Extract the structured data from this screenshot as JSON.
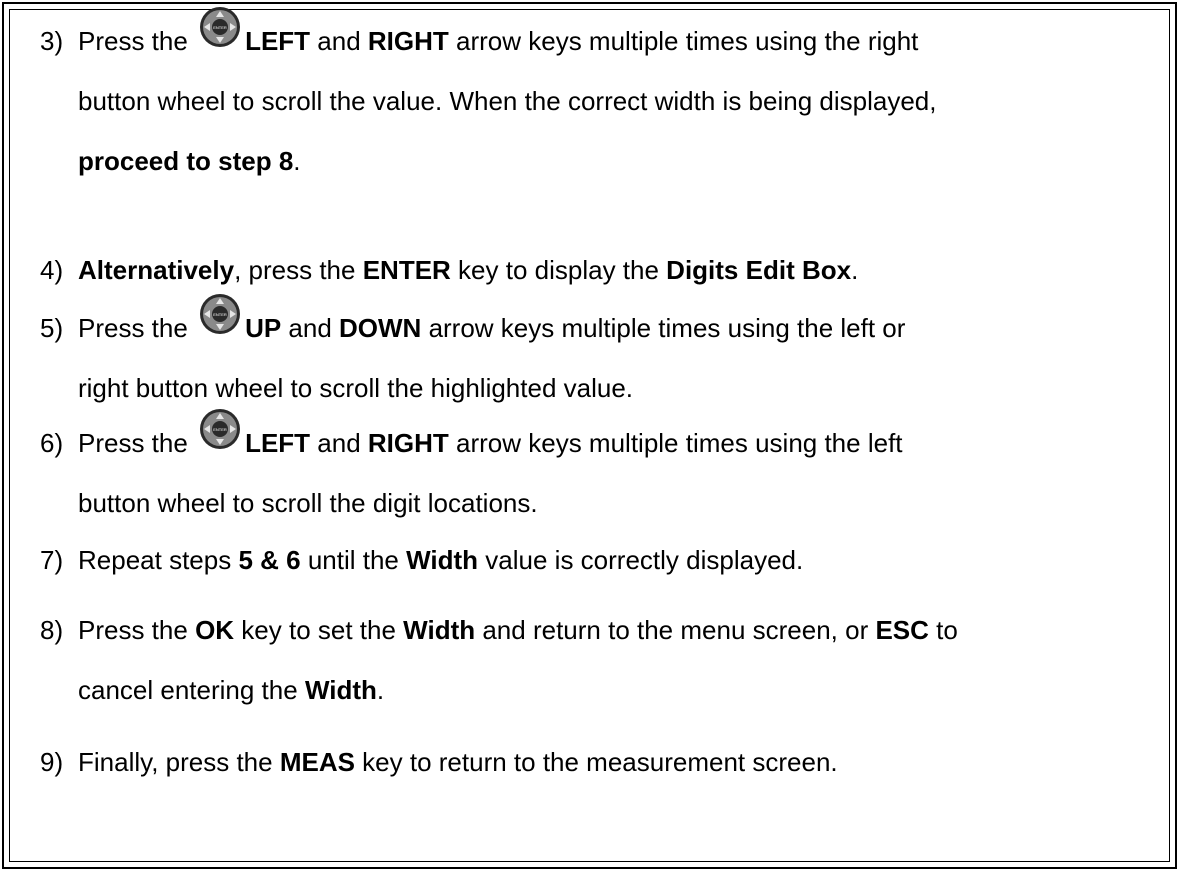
{
  "steps": [
    {
      "number": "3)",
      "parts": {
        "pre": "Press the ",
        "k1": "LEFT",
        "m1": " and ",
        "k2": "RIGHT",
        "m2": " arrow keys multiple times using the right",
        "l2": "button wheel to scroll the value.  When the correct width is being displayed,",
        "k3": "proceed to step 8",
        "end": "."
      },
      "icon": "button-wheel-icon"
    },
    {
      "number": "4)",
      "parts": {
        "k1": "Alternatively",
        "m1": ", press the ",
        "k2": "ENTER",
        "m2": " key to display the ",
        "k3": "Digits Edit Box",
        "end": "."
      }
    },
    {
      "number": "5)",
      "parts": {
        "pre": "Press the ",
        "k1": "UP",
        "m1": " and ",
        "k2": "DOWN",
        "m2": " arrow keys multiple times using the left or",
        "l2": "right button wheel to scroll the highlighted value."
      },
      "icon": "button-wheel-icon"
    },
    {
      "number": "6)",
      "parts": {
        "pre": "Press the ",
        "k1": "LEFT",
        "m1": " and ",
        "k2": "RIGHT",
        "m2": " arrow keys multiple times using the left",
        "l2": "button wheel to scroll the digit locations."
      },
      "icon": "button-wheel-icon"
    },
    {
      "number": "7)",
      "parts": {
        "pre": "Repeat steps ",
        "k1": "5 & 6",
        "m1": " until the ",
        "k2": "Width",
        "m2": " value is correctly displayed."
      }
    },
    {
      "number": "8)",
      "parts": {
        "pre": "Press the ",
        "k1": "OK",
        "m1": " key to set the ",
        "k2": "Width",
        "m2": " and return to the menu screen, or ",
        "k3": "ESC",
        "m3": " to",
        "l2": "cancel entering the ",
        "k4": "Width",
        "end": "."
      }
    },
    {
      "number": "9)",
      "parts": {
        "pre": "Finally, press the ",
        "k1": "MEAS",
        "m1": " key to return to the measurement screen."
      }
    }
  ],
  "icon_label": "ENTER",
  "colors": {
    "text": "#000000",
    "wheel_dark": "#2a2a2a",
    "wheel_mid": "#8a8a8a",
    "wheel_light": "#e6e6e6"
  }
}
